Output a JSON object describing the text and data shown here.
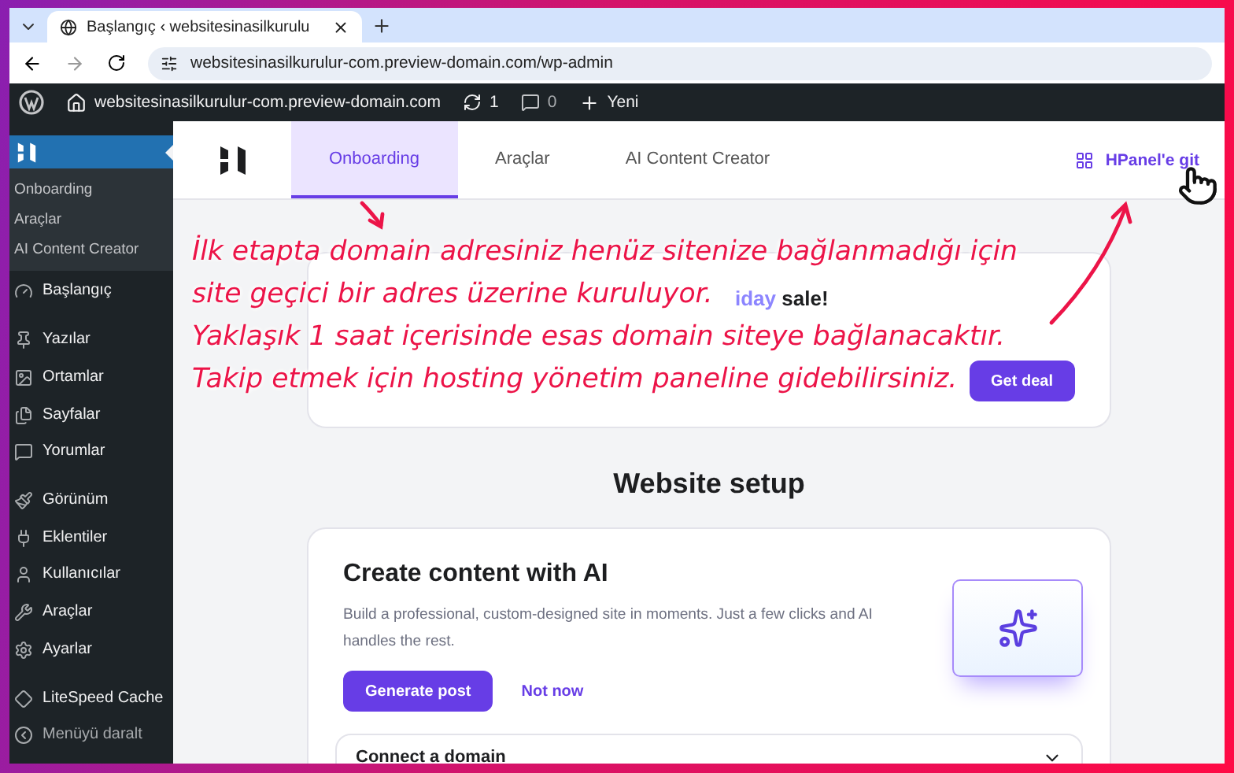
{
  "browser": {
    "tab_title": "Başlangıç ‹ websitesinasilkurulu",
    "url": "websitesinasilkurulur-com.preview-domain.com/wp-admin"
  },
  "admin_bar": {
    "site": "websitesinasilkurulur-com.preview-domain.com",
    "updates": "1",
    "comments": "0",
    "new": "Yeni"
  },
  "sidebar": {
    "header_selected": true,
    "submenu": [
      {
        "label": "Onboarding",
        "selected": false
      },
      {
        "label": "Araçlar",
        "selected": false
      },
      {
        "label": "AI Content Creator",
        "selected": false
      }
    ],
    "items": [
      {
        "label": "Başlangıç"
      },
      {
        "label": "Yazılar"
      },
      {
        "label": "Ortamlar"
      },
      {
        "label": "Sayfalar"
      },
      {
        "label": "Yorumlar"
      },
      {
        "label": "Görünüm"
      },
      {
        "label": "Eklentiler"
      },
      {
        "label": "Kullanıcılar"
      },
      {
        "label": "Araçlar"
      },
      {
        "label": "Ayarlar"
      },
      {
        "label": "LiteSpeed Cache"
      },
      {
        "label": "Menüyü daralt"
      }
    ]
  },
  "tabs": [
    {
      "label": "Onboarding",
      "selected": true
    },
    {
      "label": "Araçlar",
      "selected": false
    },
    {
      "label": "AI Content Creator",
      "selected": false
    }
  ],
  "hpanel_link": "HPanel'e git",
  "banner": {
    "title_accent": "iday",
    "title_rest": "sale!",
    "button": "Get deal"
  },
  "annotation": [
    "İlk etapta domain adresiniz henüz sitenize bağlanmadığı için",
    "site geçici bir adres üzerine kuruluyor.",
    "Yaklaşık 1 saat içerisinde esas domain siteye bağlanacaktır.",
    "Takip etmek için hosting yönetim paneline gidebilirsiniz."
  ],
  "setup": {
    "heading": "Website setup",
    "card_title": "Create content with AI",
    "card_text": "Build a professional, custom-designed site in moments. Just a few clicks and AI handles the rest.",
    "primary": "Generate post",
    "secondary": "Not now",
    "next_step": "Connect a domain"
  }
}
